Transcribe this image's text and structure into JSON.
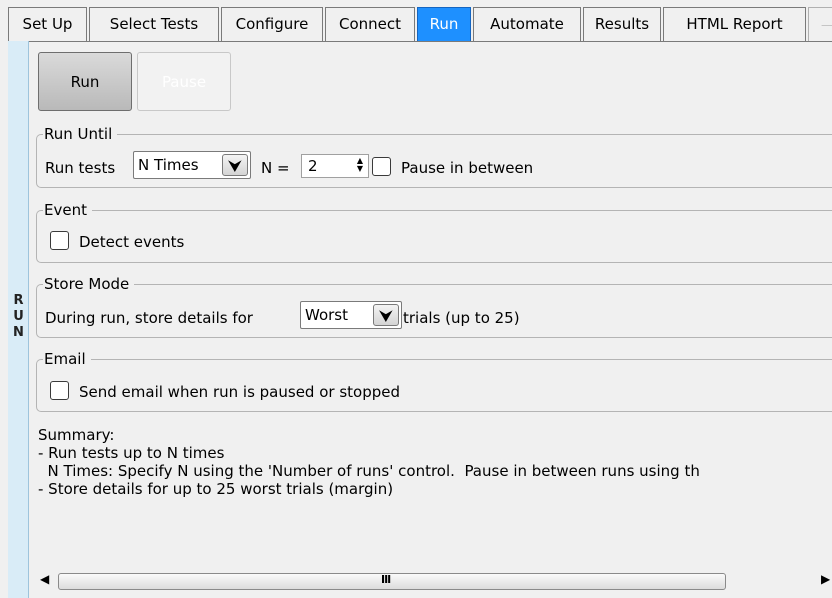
{
  "tabs": [
    {
      "label": "Set Up",
      "active": false
    },
    {
      "label": "Select Tests",
      "active": false
    },
    {
      "label": "Configure",
      "active": false
    },
    {
      "label": "Connect",
      "active": false
    },
    {
      "label": "Run",
      "active": true
    },
    {
      "label": "Automate",
      "active": false
    },
    {
      "label": "Results",
      "active": false
    },
    {
      "label": "HTML Report",
      "active": false
    }
  ],
  "side_label": [
    "R",
    "U",
    "N"
  ],
  "buttons": {
    "run": "Run",
    "pause": "Pause",
    "pause_enabled": false
  },
  "run_until": {
    "legend": "Run Until",
    "prefix": "Run tests",
    "mode_value": "N Times",
    "n_label": "N =",
    "n_value": "2",
    "pause_label": "Pause in between",
    "pause_checked": false
  },
  "event": {
    "legend": "Event",
    "detect_label": "Detect events",
    "detect_checked": false
  },
  "store_mode": {
    "legend": "Store Mode",
    "prefix": "During run, store details for",
    "mode_value": "Worst",
    "suffix": "trials (up to 25)"
  },
  "email": {
    "legend": "Email",
    "send_label": "Send email when run is paused or stopped",
    "send_checked": false
  },
  "summary": {
    "heading": "Summary:",
    "lines": [
      "- Run tests up to N times",
      "  N Times: Specify N using the 'Number of runs' control.  Pause in between runs using th",
      "- Store details for up to 25 worst trials (margin)"
    ]
  },
  "scrollbar": {
    "left_arrow": "◀",
    "right_arrow": "▶",
    "grip": "III"
  },
  "colors": {
    "active_tab": "#1e90ff",
    "side_panel": "#d9ecf7"
  }
}
